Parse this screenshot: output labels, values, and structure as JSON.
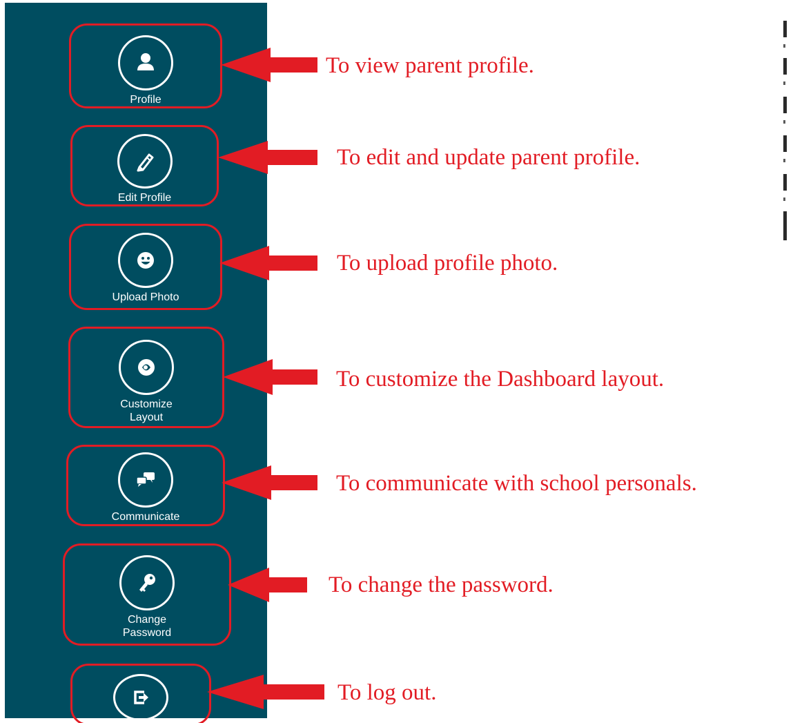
{
  "sidebar": {
    "background_color": "#004d60",
    "items": [
      {
        "label": "Profile",
        "icon": "user-icon"
      },
      {
        "label": "Edit Profile",
        "icon": "pencil-icon"
      },
      {
        "label": "Upload Photo",
        "icon": "smiley-icon"
      },
      {
        "label": "Customize Layout",
        "icon": "layout-icon"
      },
      {
        "label": "Communicate",
        "icon": "chat-bubbles-icon"
      },
      {
        "label": "Change Password",
        "icon": "key-icon"
      },
      {
        "label": "",
        "icon": "logout-icon"
      }
    ]
  },
  "annotations": [
    "To view parent profile.",
    "To edit and update parent profile.",
    "To upload profile photo.",
    "To customize the Dashboard layout.",
    "To communicate with school personals.",
    "To change the password.",
    "To log out."
  ],
  "colors": {
    "annotation": "#e21c24",
    "highlight_border": "#e21c24",
    "icon": "#ffffff"
  }
}
